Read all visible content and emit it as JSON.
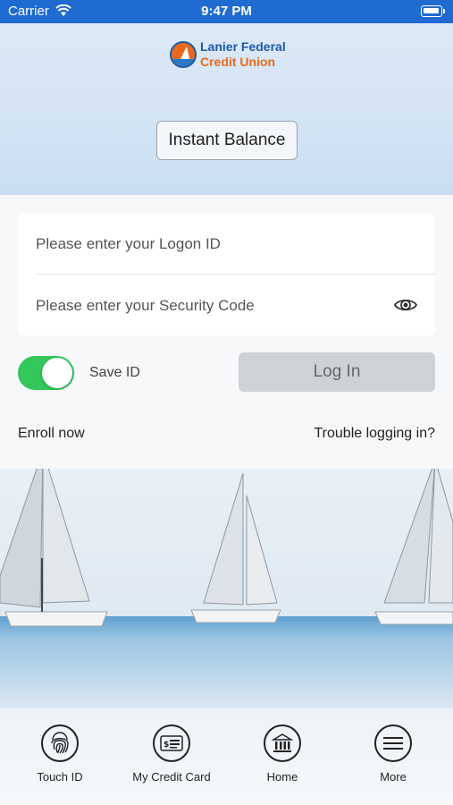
{
  "status_bar": {
    "carrier": "Carrier",
    "time": "9:47 PM"
  },
  "header": {
    "logo_line1": "Lanier Federal",
    "logo_line2": "Credit Union",
    "instant_balance_label": "Instant Balance"
  },
  "login_form": {
    "logon_placeholder": "Please enter your Logon ID",
    "security_placeholder": "Please enter your Security Code",
    "save_id_label": "Save ID",
    "save_id_enabled": true,
    "login_button": "Log In",
    "enroll_link": "Enroll now",
    "trouble_link": "Trouble logging in?"
  },
  "tab_bar": {
    "items": [
      {
        "label": "Touch ID",
        "icon": "fingerprint-icon"
      },
      {
        "label": "My Credit Card",
        "icon": "credit-card-icon"
      },
      {
        "label": "Home",
        "icon": "bank-icon"
      },
      {
        "label": "More",
        "icon": "menu-icon"
      }
    ]
  },
  "colors": {
    "status_bar": "#1f6bd1",
    "brand_blue": "#1f5aa8",
    "brand_orange": "#e86a1f",
    "toggle_on": "#34c759"
  }
}
